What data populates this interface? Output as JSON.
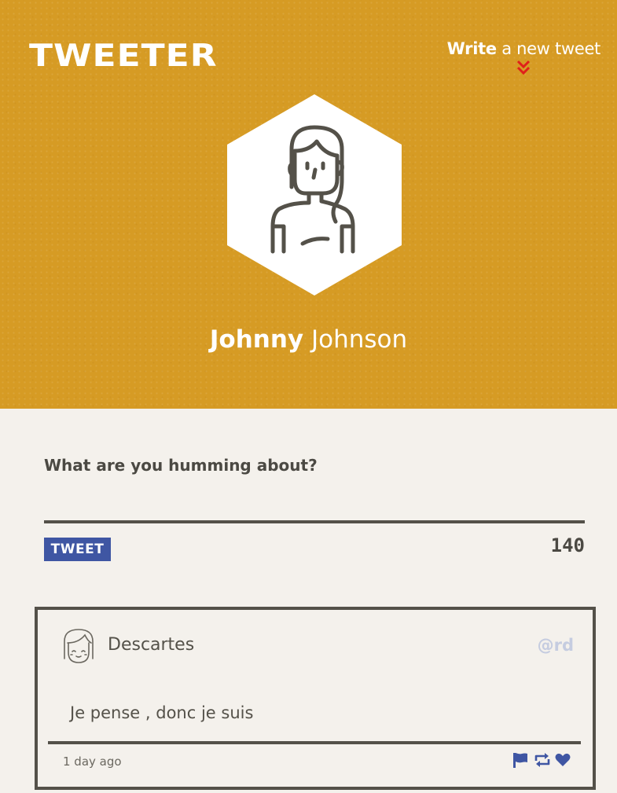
{
  "header": {
    "logo": "TWEETER",
    "compose_link": {
      "strong": "Write",
      "light": "a new tweet"
    },
    "user": {
      "first_name": "Johnny",
      "last_name": "Johnson"
    }
  },
  "composer": {
    "prompt": "What are you humming about?",
    "text_value": "",
    "button_label": "TWEET",
    "char_count": "140"
  },
  "tweets": [
    {
      "author": "Descartes",
      "handle": "@rd",
      "content": "Je pense , donc je suis",
      "time": "1 day ago",
      "actions": [
        "flag-icon",
        "retweet-icon",
        "heart-icon"
      ]
    }
  ],
  "colors": {
    "header_bg": "#d69b24",
    "page_bg": "#f4f1ec",
    "accent_blue": "#3f56a3",
    "chevron_red": "#e0201a",
    "text_dark": "#545149"
  }
}
